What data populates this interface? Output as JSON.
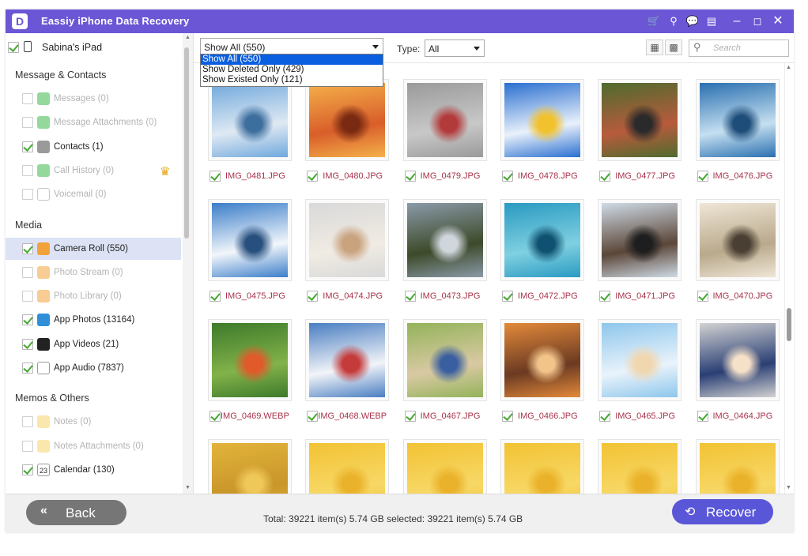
{
  "app": {
    "title": "Eassiy iPhone Data Recovery",
    "logo_letter": "D"
  },
  "titlebar_icons": [
    "cart-icon",
    "key-icon",
    "chat-icon",
    "feedback-icon",
    "minimize-icon",
    "maximize-icon",
    "close-icon"
  ],
  "sidebar": {
    "device": "Sabina's iPad",
    "sections": [
      {
        "title": "Message & Contacts",
        "items": [
          {
            "label": "Messages (0)",
            "checked": false,
            "disabled": true,
            "icon": "messages-icon",
            "color": "#3cba48"
          },
          {
            "label": "Message Attachments (0)",
            "checked": false,
            "disabled": true,
            "icon": "attachment-icon",
            "color": "#3cba48"
          },
          {
            "label": "Contacts (1)",
            "checked": true,
            "disabled": false,
            "icon": "contacts-icon",
            "color": "#9a9a9a"
          },
          {
            "label": "Call History (0)",
            "checked": false,
            "disabled": true,
            "icon": "phone-icon",
            "color": "#3cba48",
            "crown": true
          },
          {
            "label": "Voicemail (0)",
            "checked": false,
            "disabled": true,
            "icon": "voicemail-icon",
            "color": "#ffffff"
          }
        ]
      },
      {
        "title": "Media",
        "items": [
          {
            "label": "Camera Roll (550)",
            "checked": true,
            "disabled": false,
            "active": true,
            "icon": "camera-roll-icon",
            "color": "#f2a23a"
          },
          {
            "label": "Photo Stream (0)",
            "checked": false,
            "disabled": true,
            "icon": "photo-stream-icon",
            "color": "#f2a23a"
          },
          {
            "label": "Photo Library (0)",
            "checked": false,
            "disabled": true,
            "icon": "photo-library-icon",
            "color": "#f2a23a"
          },
          {
            "label": "App Photos (13164)",
            "checked": true,
            "disabled": false,
            "icon": "app-photos-icon",
            "color": "#2f8fd8"
          },
          {
            "label": "App Videos (21)",
            "checked": true,
            "disabled": false,
            "icon": "app-videos-icon",
            "color": "#222222"
          },
          {
            "label": "App Audio (7837)",
            "checked": true,
            "disabled": false,
            "icon": "app-audio-icon",
            "color": "#ffffff"
          }
        ]
      },
      {
        "title": "Memos & Others",
        "items": [
          {
            "label": "Notes (0)",
            "checked": false,
            "disabled": true,
            "icon": "notes-icon",
            "color": "#f5d36b"
          },
          {
            "label": "Notes Attachments (0)",
            "checked": false,
            "disabled": true,
            "icon": "notes-attachment-icon",
            "color": "#f5d36b"
          },
          {
            "label": "Calendar (130)",
            "checked": true,
            "disabled": false,
            "icon": "calendar-icon",
            "color": "#ffffff",
            "glyph": "23"
          }
        ]
      }
    ]
  },
  "toolbar": {
    "filter_value": "Show All (550)",
    "filter_options": [
      "Show All (550)",
      "Show Deleted Only (429)",
      "Show Existed Only (121)"
    ],
    "type_label": "Type:",
    "type_value": "All",
    "search_placeholder": "Search"
  },
  "photos": [
    {
      "name": "IMG_0481.JPG",
      "colors": [
        "#6fa8dc",
        "#dfe9f3",
        "#3c6e9e"
      ]
    },
    {
      "name": "IMG_0480.JPG",
      "colors": [
        "#f5b14a",
        "#d85e2a",
        "#7a2a12"
      ]
    },
    {
      "name": "IMG_0479.JPG",
      "colors": [
        "#9a9a9a",
        "#c8c8c8",
        "#b33a3a"
      ]
    },
    {
      "name": "IMG_0478.JPG",
      "colors": [
        "#2a6fd0",
        "#e9f1fb",
        "#f2c12e"
      ]
    },
    {
      "name": "IMG_0477.JPG",
      "colors": [
        "#4e6b2e",
        "#b85b3c",
        "#2a2a2a"
      ]
    },
    {
      "name": "IMG_0476.JPG",
      "colors": [
        "#2a70b0",
        "#c5dff0",
        "#1e4d7a"
      ]
    },
    {
      "name": "IMG_0475.JPG",
      "colors": [
        "#3b7ec9",
        "#f2f6fb",
        "#27507e"
      ]
    },
    {
      "name": "IMG_0474.JPG",
      "colors": [
        "#d9d9d9",
        "#f0ebe3",
        "#c9a27e"
      ]
    },
    {
      "name": "IMG_0473.JPG",
      "colors": [
        "#8a9aa8",
        "#3d4a2a",
        "#d0d6dc"
      ]
    },
    {
      "name": "IMG_0472.JPG",
      "colors": [
        "#2a9ac2",
        "#7fd0e0",
        "#0f5170"
      ]
    },
    {
      "name": "IMG_0471.JPG",
      "colors": [
        "#cfdbe6",
        "#5b4638",
        "#1e1e1e"
      ]
    },
    {
      "name": "IMG_0470.JPG",
      "colors": [
        "#efe6d6",
        "#b9a98c",
        "#4a3f33"
      ]
    },
    {
      "name": "IMG_0469.WEBP",
      "colors": [
        "#3d7a2a",
        "#82b24a",
        "#e05a2a"
      ]
    },
    {
      "name": "IMG_0468.WEBP",
      "colors": [
        "#4a7ec2",
        "#f2f4f8",
        "#c53a3a"
      ]
    },
    {
      "name": "IMG_0467.JPG",
      "colors": [
        "#93b35a",
        "#d9c9a3",
        "#3a5fa0"
      ]
    },
    {
      "name": "IMG_0466.JPG",
      "colors": [
        "#e38a3a",
        "#6b3a22",
        "#f2c48a"
      ]
    },
    {
      "name": "IMG_0465.JPG",
      "colors": [
        "#8ec6ec",
        "#e9f3fb",
        "#f0d7b0"
      ]
    },
    {
      "name": "IMG_0464.JPG",
      "colors": [
        "#d2d2d2",
        "#2a3f74",
        "#f5e0c8"
      ]
    },
    {
      "name": "",
      "colors": [
        "#e2b43a",
        "#c9962a",
        "#f0c85a"
      ]
    },
    {
      "name": "",
      "colors": [
        "#f2c233",
        "#f7d866",
        "#eab22a"
      ]
    },
    {
      "name": "",
      "colors": [
        "#f2c233",
        "#f7d866",
        "#eab22a"
      ]
    },
    {
      "name": "",
      "colors": [
        "#f2c233",
        "#f7d866",
        "#eab22a"
      ]
    },
    {
      "name": "",
      "colors": [
        "#f2c233",
        "#f7d866",
        "#eab22a"
      ]
    },
    {
      "name": "",
      "colors": [
        "#f2c233",
        "#f7d866",
        "#eab22a"
      ]
    }
  ],
  "footer": {
    "back_label": "Back",
    "status": "Total: 39221 item(s) 5.74 GB   selected: 39221 item(s) 5.74 GB",
    "recover_label": "Recover"
  }
}
